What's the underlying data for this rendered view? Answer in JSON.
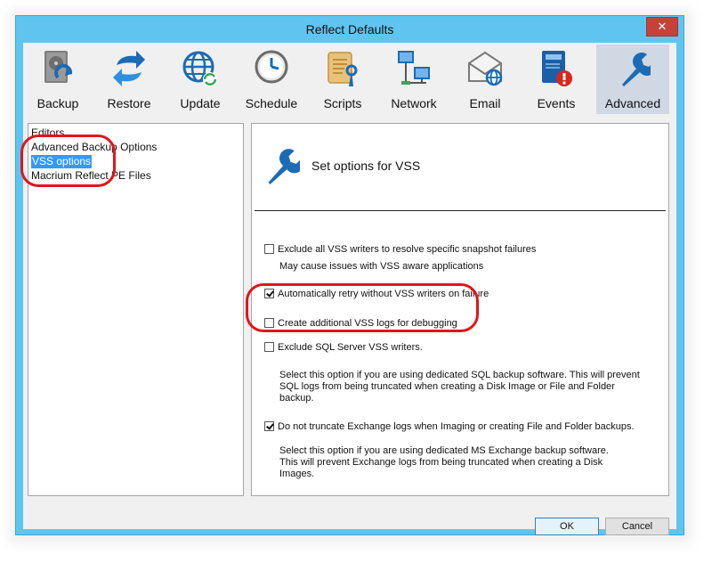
{
  "window": {
    "title": "Reflect Defaults",
    "close_glyph": "✕"
  },
  "toolbar": {
    "items": [
      {
        "label": "Backup",
        "icon": "backup-drive-icon"
      },
      {
        "label": "Restore",
        "icon": "restore-arrows-icon"
      },
      {
        "label": "Update",
        "icon": "update-globe-icon"
      },
      {
        "label": "Schedule",
        "icon": "schedule-clock-icon"
      },
      {
        "label": "Scripts",
        "icon": "scripts-scroll-icon"
      },
      {
        "label": "Network",
        "icon": "network-computers-icon"
      },
      {
        "label": "Email",
        "icon": "email-envelope-icon"
      },
      {
        "label": "Events",
        "icon": "events-book-icon"
      },
      {
        "label": "Advanced",
        "icon": "wrench-icon",
        "selected": true
      }
    ]
  },
  "tree": {
    "items": [
      {
        "label": "Editors"
      },
      {
        "label": "Advanced Backup Options"
      },
      {
        "label": "VSS options",
        "selected": true
      },
      {
        "label": "Macrium Reflect PE Files"
      }
    ]
  },
  "panel": {
    "title": "Set options for VSS",
    "options": [
      {
        "label": "Exclude all VSS writers to resolve specific snapshot failures",
        "checked": false,
        "description": [
          "May cause issues with VSS aware applications"
        ]
      },
      {
        "label": "Automatically retry without VSS writers on failure",
        "checked": true
      },
      {
        "label": "Create additional VSS logs for debugging",
        "checked": false
      },
      {
        "label": "Exclude SQL Server VSS writers.",
        "checked": false,
        "description": [
          "Select this option if you are using dedicated SQL backup software. This will prevent",
          "SQL logs from being truncated when creating a Disk Image or File and Folder",
          "backup."
        ]
      },
      {
        "label": "Do not truncate Exchange logs when Imaging or creating File and Folder backups.",
        "checked": true,
        "description": [
          "Select this option if you are using dedicated MS Exchange backup software.",
          "This will prevent Exchange  logs from being truncated when creating a Disk",
          "Images."
        ]
      }
    ]
  },
  "buttons": {
    "ok": "OK",
    "cancel": "Cancel"
  },
  "colors": {
    "titlebar": "#5fc5f0",
    "selection": "#3399ff",
    "annotation": "#e2141c",
    "icon_blue": "#1b6bb5"
  }
}
